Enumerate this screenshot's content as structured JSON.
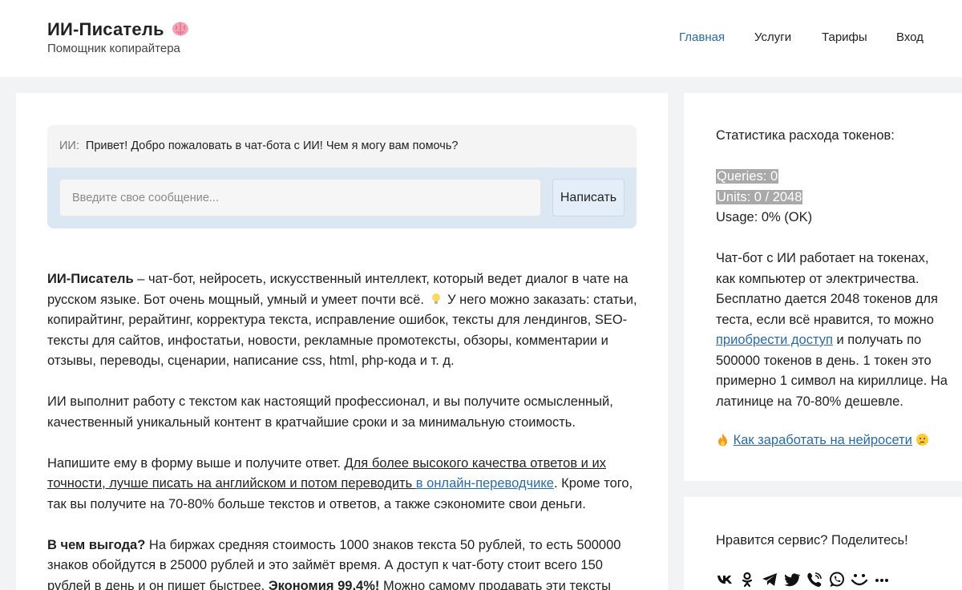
{
  "header": {
    "title": "ИИ-Писатель",
    "title_icon": "brain-emoji",
    "subtitle": "Помощник копирайтера",
    "nav": [
      "Главная",
      "Услуги",
      "Тарифы",
      "Вход"
    ],
    "active_nav": "Главная"
  },
  "chat": {
    "sender": "ИИ:",
    "greeting": "Привет! Добро пожаловать в чат-бота с ИИ! Чем я могу вам помочь?",
    "input_placeholder": "Введите свое сообщение...",
    "send_label": "Написать"
  },
  "article": {
    "p1": {
      "bold": "ИИ-Писатель",
      "text1": " – чат-бот, нейросеть, искусственный интеллект, который ведет диалог в чате на русском языке. Бот очень мощный, умный и умеет почти всё.",
      "icon": "lightbulb-emoji",
      "text2": " У него можно заказать: статьи, копирайтинг, рерайтинг, корректура текста, исправление ошибок, тексты для лендингов, SEO-тексты для сайтов, инфостатьи, новости, рекламные промотексты, обзоры, комментарии и отзывы, переводы, сценарии, написание css, html, php-кода и т. д."
    },
    "p2": "ИИ выполнит работу с текстом как настоящий профессионал, и вы получите осмысленный, качественный уникальный контент в кратчайшие сроки и за минимальную стоимость.",
    "p3": {
      "text1": "Напишите ему в форму выше и получите ответ. ",
      "underlined": "Для более высокого качества ответов и их точности, лучше писать на английском и потом переводить ",
      "link": "в онлайн-переводчике",
      "text2": ". Кроме того, так вы получите на 70-80% больше текстов и ответов, а также сэкономите свои деньги."
    },
    "p4": {
      "bold1": "В чем выгода?",
      "text1": " На биржах средняя стоимость 1000 знаков текста 50 рублей, то есть 500000 знаков обойдутся в 25000 рублей и это займёт время. А доступ к чат-боту стоит всего 150 рублей в день и он пишет быстрее. ",
      "bold2": "Экономия 99,4%!",
      "text2": " Можно самому продавать эти тексты"
    }
  },
  "sidebar": {
    "stats_title": "Статистика расхода токенов:",
    "queries": "Queries: 0",
    "units": "Units: 0 / 2048",
    "usage": "Usage: 0% (OK)",
    "info_text1": "Чат-бот с ИИ работает на токенах, как компьютер от электричества. Бесплатно дается 2048 токенов для теста, если всё нравится, то можно ",
    "info_link": "приобрести доступ",
    "info_text2": " и получать по 500000 токенов в день. 1 токен это примерно 1 символ на кириллице. На латинице на 70-80% дешевле.",
    "earn_icon_left": "fire-emoji",
    "earn_link": "Как заработать на нейросети",
    "earn_icon_right": "thinking-emoji",
    "share_title": "Нравится сервис? Поделитесь!",
    "share_icons": [
      "vk-icon",
      "odnoklassniki-icon",
      "telegram-icon",
      "twitter-icon",
      "viber-icon",
      "whatsapp-icon",
      "moimir-icon",
      "more-icon"
    ]
  },
  "colors": {
    "link": "#2d6a9f",
    "chat_bg": "#dbe8f4",
    "highlight": "#a9a9a9",
    "page_bg": "#f1f3f5"
  }
}
